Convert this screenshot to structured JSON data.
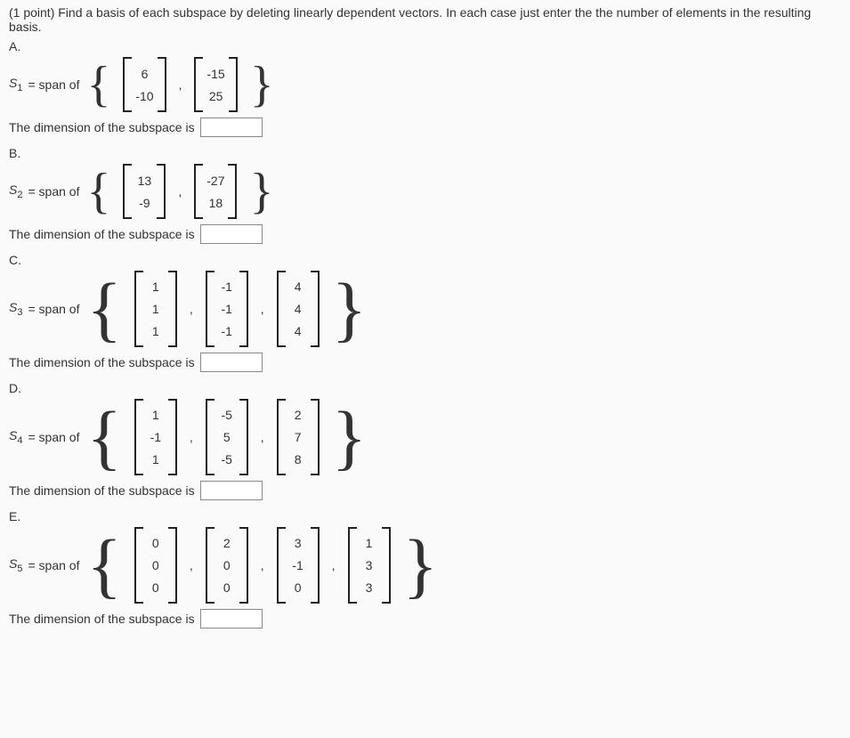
{
  "intro": "(1 point) Find a basis of each subspace by deleting linearly dependent vectors. In each case just enter the the number of elements in the resulting basis.",
  "dim_text": "The dimension of the subspace is",
  "span_text": " = span of",
  "parts": {
    "A": {
      "label": "A.",
      "svar": "S",
      "snum": "1",
      "size": 2,
      "vectors": [
        [
          "6",
          "-10"
        ],
        [
          "-15",
          "25"
        ]
      ],
      "answer": ""
    },
    "B": {
      "label": "B.",
      "svar": "S",
      "snum": "2",
      "size": 2,
      "vectors": [
        [
          "13",
          "-9"
        ],
        [
          "-27",
          "18"
        ]
      ],
      "answer": ""
    },
    "C": {
      "label": "C.",
      "svar": "S",
      "snum": "3",
      "size": 3,
      "vectors": [
        [
          "1",
          "1",
          "1"
        ],
        [
          "-1",
          "-1",
          "-1"
        ],
        [
          "4",
          "4",
          "4"
        ]
      ],
      "answer": ""
    },
    "D": {
      "label": "D.",
      "svar": "S",
      "snum": "4",
      "size": 3,
      "vectors": [
        [
          "1",
          "-1",
          "1"
        ],
        [
          "-5",
          "5",
          "-5"
        ],
        [
          "2",
          "7",
          "8"
        ]
      ],
      "answer": ""
    },
    "E": {
      "label": "E.",
      "svar": "S",
      "snum": "5",
      "size": 3,
      "vectors": [
        [
          "0",
          "0",
          "0"
        ],
        [
          "2",
          "0",
          "0"
        ],
        [
          "3",
          "-1",
          "0"
        ],
        [
          "1",
          "3",
          "3"
        ]
      ],
      "answer": ""
    }
  }
}
